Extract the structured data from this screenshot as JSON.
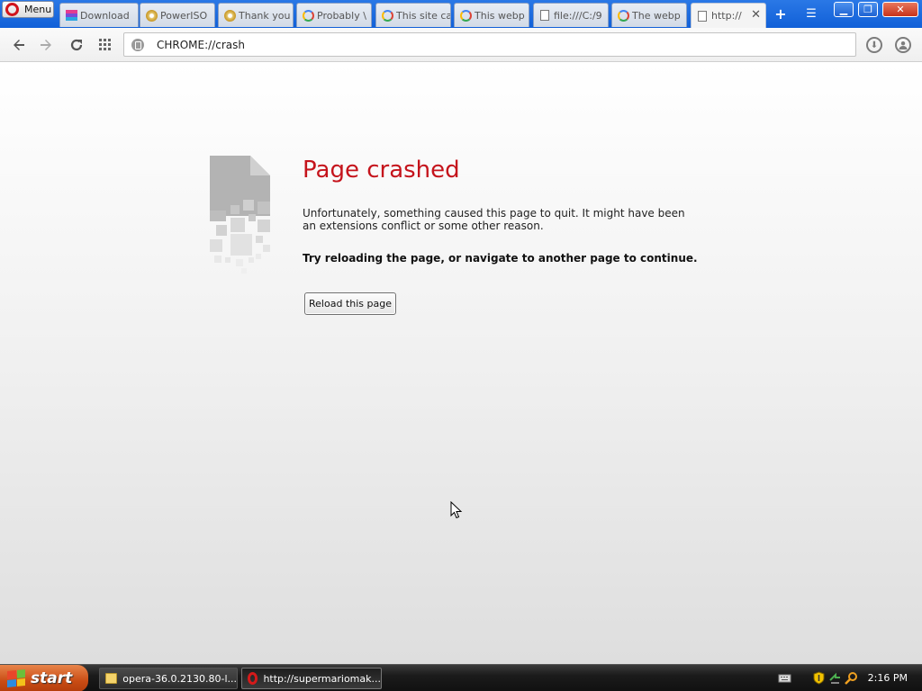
{
  "browser": {
    "menu_label": "Menu",
    "tabs": [
      {
        "label": "Download",
        "icon": "download-favicon-icon"
      },
      {
        "label": "PowerISO",
        "icon": "poweriso-favicon-icon"
      },
      {
        "label": "Thank you",
        "icon": "poweriso-favicon-icon"
      },
      {
        "label": "Probably \\",
        "icon": "google-favicon-icon"
      },
      {
        "label": "This site ca",
        "icon": "google-favicon-icon"
      },
      {
        "label": "This webp",
        "icon": "google-favicon-icon"
      },
      {
        "label": "file:///C:/9",
        "icon": "document-favicon-icon"
      },
      {
        "label": "The webp",
        "icon": "google-favicon-icon"
      },
      {
        "label": "http://",
        "icon": "document-favicon-icon",
        "active": true
      }
    ],
    "address_url": "CHROME://crash"
  },
  "page": {
    "title": "Page crashed",
    "message": "Unfortunately, something caused this page to quit. It might have been an extensions conflict or some other reason.",
    "hint": "Try reloading the page, or navigate to another page to continue.",
    "reload_label": "Reload this page",
    "title_color": "#c5141c"
  },
  "taskbar": {
    "start_label": "start",
    "tasks": [
      {
        "label": "opera-36.0.2130.80-l...",
        "icon": "folder-icon"
      },
      {
        "label": "http://supermariomak...",
        "icon": "opera-icon",
        "active": true
      }
    ],
    "clock": "2:16 PM"
  }
}
